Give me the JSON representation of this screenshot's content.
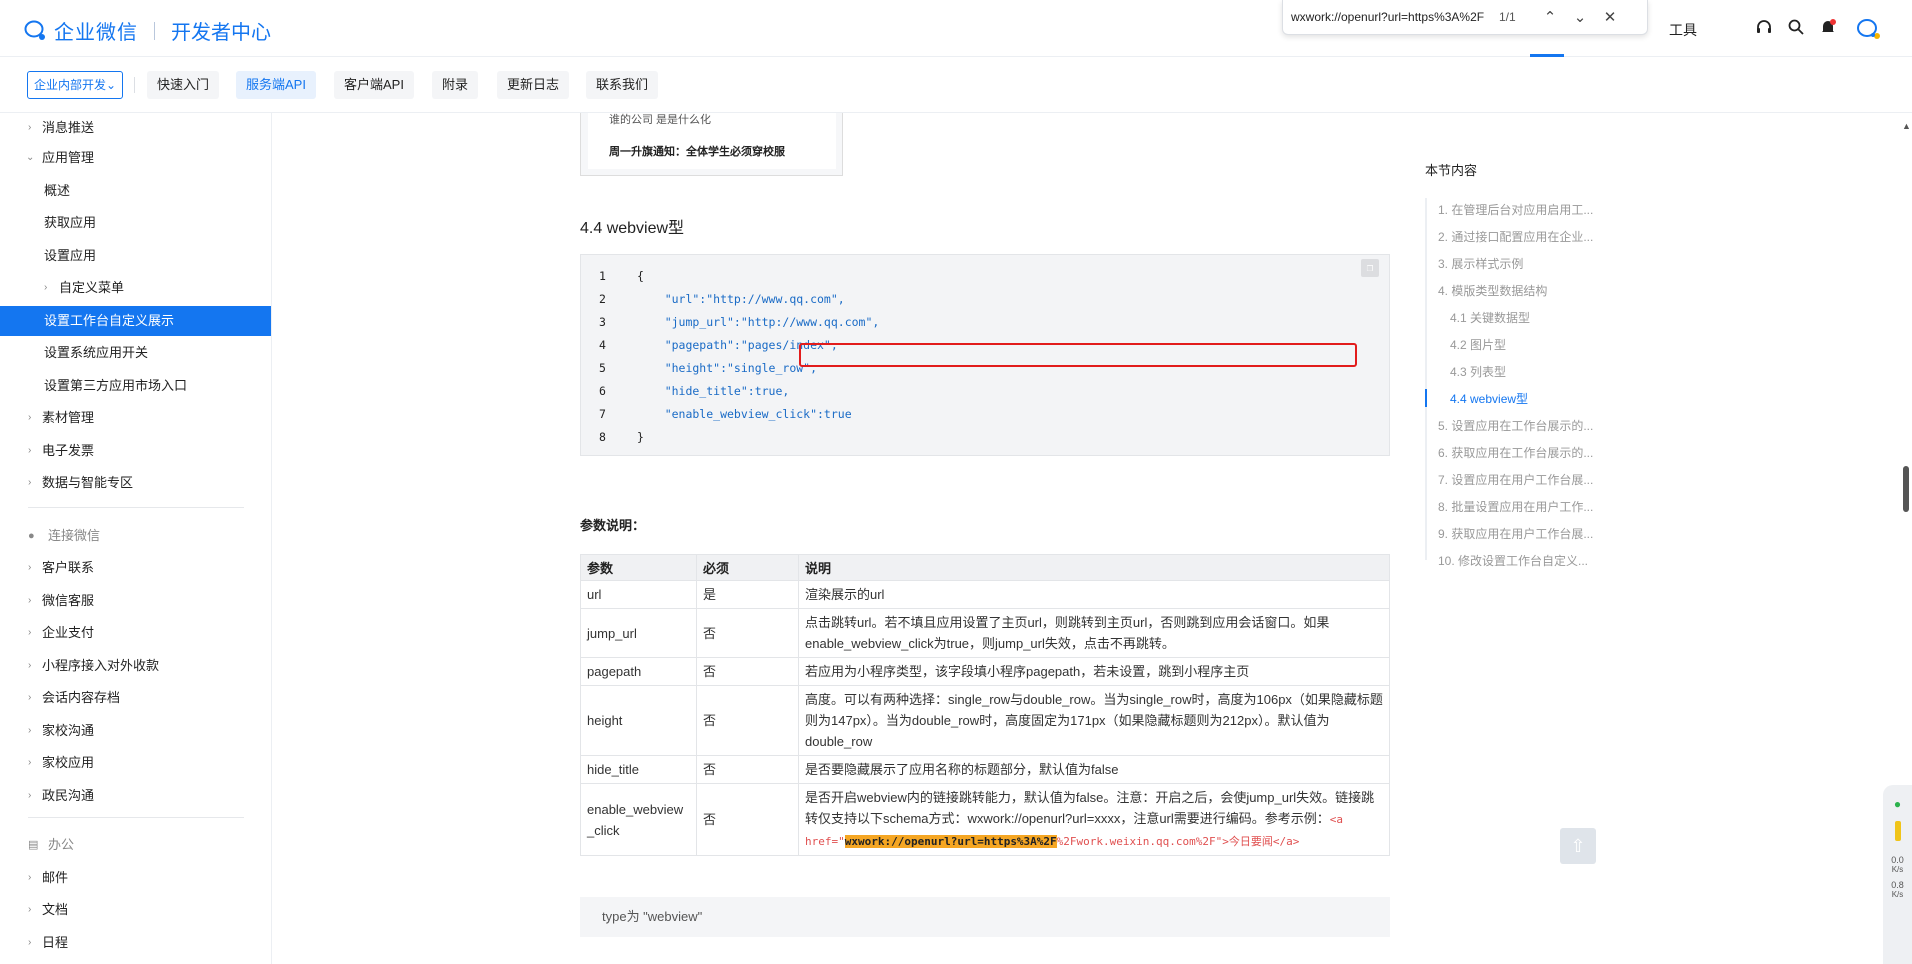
{
  "header": {
    "logo": "企业微信",
    "subtitle": "开发者中心",
    "find": {
      "query": "wxwork://openurl?url=https%3A%2F",
      "count": "1/1"
    },
    "tools_label": "工具",
    "icons": [
      "headset-icon",
      "search-icon",
      "bell-icon",
      "wecom-icon"
    ]
  },
  "nav": {
    "dept_button": "企业内部开发",
    "items": [
      {
        "label": "快速入门",
        "active": false
      },
      {
        "label": "服务端API",
        "active": true
      },
      {
        "label": "客户端API",
        "active": false
      },
      {
        "label": "附录",
        "active": false
      },
      {
        "label": "更新日志",
        "active": false
      },
      {
        "label": "联系我们",
        "active": false
      }
    ]
  },
  "sidebar": {
    "items": [
      {
        "label": "消息推送",
        "level": 0,
        "chev": "right"
      },
      {
        "label": "应用管理",
        "level": 0,
        "chev": "down"
      },
      {
        "label": "概述",
        "level": 1
      },
      {
        "label": "获取应用",
        "level": 1
      },
      {
        "label": "设置应用",
        "level": 1
      },
      {
        "label": "自定义菜单",
        "level": 1,
        "chev": "right"
      },
      {
        "label": "设置工作台自定义展示",
        "level": 1,
        "active": true
      },
      {
        "label": "设置系统应用开关",
        "level": 1
      },
      {
        "label": "设置第三方应用市场入口",
        "level": 1
      },
      {
        "label": "素材管理",
        "level": 0,
        "chev": "right"
      },
      {
        "label": "电子发票",
        "level": 0,
        "chev": "right"
      },
      {
        "label": "数据与智能专区",
        "level": 0,
        "chev": "right"
      },
      {
        "label": "连接微信",
        "group": true
      },
      {
        "label": "客户联系",
        "level": 0,
        "chev": "right"
      },
      {
        "label": "微信客服",
        "level": 0,
        "chev": "right"
      },
      {
        "label": "企业支付",
        "level": 0,
        "chev": "right"
      },
      {
        "label": "小程序接入对外收款",
        "level": 0,
        "chev": "right"
      },
      {
        "label": "会话内容存档",
        "level": 0,
        "chev": "right"
      },
      {
        "label": "家校沟通",
        "level": 0,
        "chev": "right"
      },
      {
        "label": "家校应用",
        "level": 0,
        "chev": "right"
      },
      {
        "label": "政民沟通",
        "level": 0,
        "chev": "right"
      },
      {
        "label": "办公",
        "group": true
      },
      {
        "label": "邮件",
        "level": 0,
        "chev": "right"
      },
      {
        "label": "文档",
        "level": 0,
        "chev": "right"
      },
      {
        "label": "日程",
        "level": 0,
        "chev": "right"
      }
    ]
  },
  "content": {
    "image_lines": [
      "谁的公司 是是什么化",
      "周一升旗通知：全体学生必须穿校服"
    ],
    "section_title": "4.4 webview型",
    "code": [
      "{",
      "    \"url\":\"http://www.qq.com\",",
      "    \"jump_url\":\"http://www.qq.com\",",
      "    \"pagepath\":\"pages/index\",",
      "    \"height\":\"single_row\",",
      "    \"hide_title\":true,",
      "    \"enable_webview_click\":true",
      "}"
    ],
    "params_title": "参数说明：",
    "table": {
      "headers": [
        "参数",
        "必须",
        "说明"
      ],
      "rows": [
        {
          "param": "url",
          "req": "是",
          "desc": "渲染展示的url"
        },
        {
          "param": "jump_url",
          "req": "否",
          "desc": "点击跳转url。若不填且应用设置了主页url，则跳转到主页url，否则跳到应用会话窗口。如果enable_webview_click为true，则jump_url失效，点击不再跳转。"
        },
        {
          "param": "pagepath",
          "req": "否",
          "desc": "若应用为小程序类型，该字段填小程序pagepath，若未设置，跳到小程序主页"
        },
        {
          "param": "height",
          "req": "否",
          "desc": "高度。可以有两种选择：single_row与double_row。当为single_row时，高度为106px（如果隐藏标题则为147px）。当为double_row时，高度固定为171px（如果隐藏标题则为212px）。默认值为double_row"
        },
        {
          "param": "hide_title",
          "req": "否",
          "desc": "是否要隐藏展示了应用名称的标题部分，默认值为false"
        },
        {
          "param": "enable_webview_click",
          "req": "否",
          "desc_a": "是否开启webview内的链接跳转能力，默认值为false。注意：开启之后，会使jump_url失效。",
          "desc_b": "链接跳转仅支持以下schema方式：wxwork://openurl?url=xxxx，注意url需要进行编码。参考示例：",
          "code_pre": "<a href=\"",
          "code_hl": "wxwork://openurl?url=https%3A%2F",
          "code_post": "%2Fwork.weixin.qq.com%2F\">今日要闻</a>"
        }
      ]
    },
    "note": "type为 \"webview\""
  },
  "toc": {
    "title": "本节内容",
    "items": [
      {
        "label": "1. 在管理后台对应用启用工...",
        "sub": false
      },
      {
        "label": "2. 通过接口配置应用在企业...",
        "sub": false
      },
      {
        "label": "3. 展示样式示例",
        "sub": false
      },
      {
        "label": "4. 模版类型数据结构",
        "sub": false
      },
      {
        "label": "4.1 关键数据型",
        "sub": true
      },
      {
        "label": "4.2 图片型",
        "sub": true
      },
      {
        "label": "4.3 列表型",
        "sub": true
      },
      {
        "label": "4.4 webview型",
        "sub": true,
        "active": true
      },
      {
        "label": "5. 设置应用在工作台展示的...",
        "sub": false
      },
      {
        "label": "6. 获取应用在工作台展示的...",
        "sub": false
      },
      {
        "label": "7. 设置应用在用户工作台展...",
        "sub": false
      },
      {
        "label": "8. 批量设置应用在用户工作...",
        "sub": false
      },
      {
        "label": "9. 获取应用在用户工作台展...",
        "sub": false
      },
      {
        "label": "10. 修改设置工作台自定义...",
        "sub": false
      }
    ]
  },
  "widget": {
    "up": "0.0",
    "up_unit": "K/s",
    "down": "0.8",
    "down_unit": "K/s"
  },
  "colors": {
    "brand": "#1476f0",
    "highlight": "#f5a623",
    "alert": "#e21c1c"
  }
}
